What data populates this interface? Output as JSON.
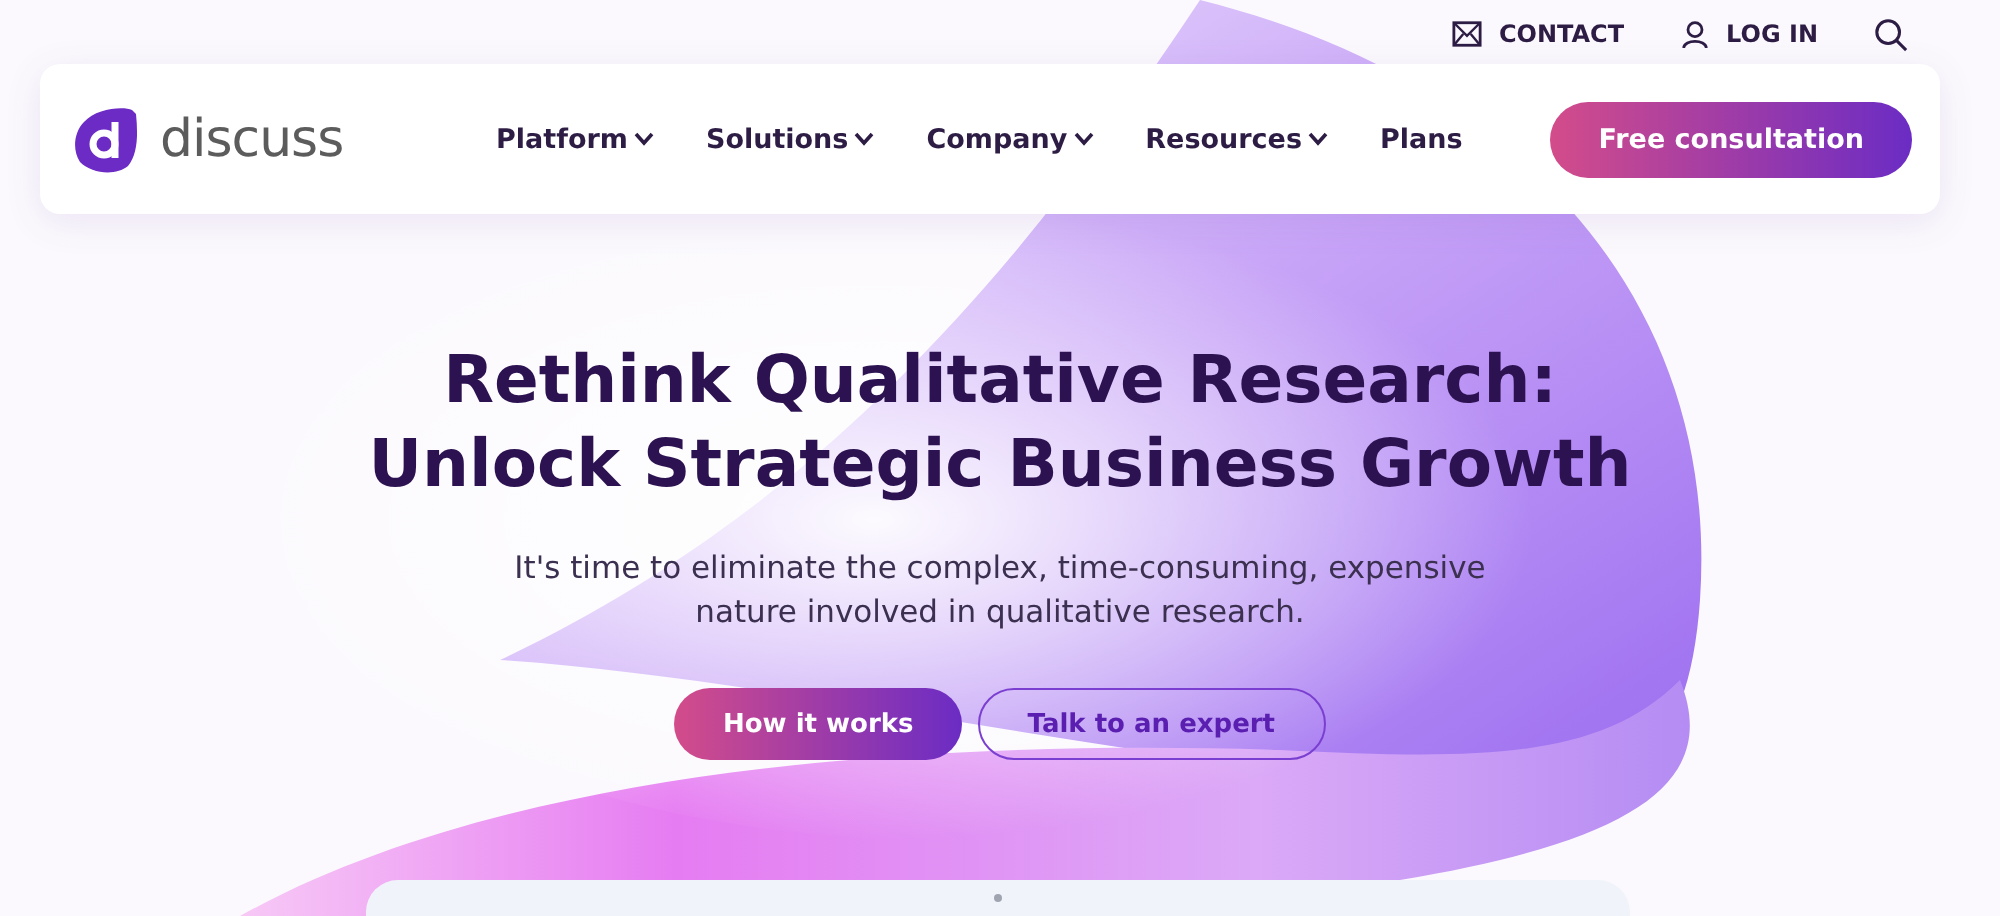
{
  "utility_links": [
    {
      "kind": "mail",
      "label": "CONTACT"
    },
    {
      "kind": "user",
      "label": "LOG IN"
    }
  ],
  "logo": {
    "text": "discuss"
  },
  "nav": [
    {
      "label": "Platform",
      "dropdown": true
    },
    {
      "label": "Solutions",
      "dropdown": true
    },
    {
      "label": "Company",
      "dropdown": true
    },
    {
      "label": "Resources",
      "dropdown": true
    },
    {
      "label": "Plans",
      "dropdown": false
    }
  ],
  "cta": {
    "label": "Free consultation"
  },
  "hero": {
    "title_lines": [
      "Rethink Qualitative Research:",
      "Unlock Strategic Business Growth"
    ],
    "subtitle_lines": [
      "It's time to eliminate the complex, time-consuming, expensive",
      "nature involved in qualitative research."
    ],
    "buttons": [
      {
        "label": "How it works",
        "kind": "primary"
      },
      {
        "label": "Talk to an expert",
        "kind": "secondary"
      }
    ]
  }
}
